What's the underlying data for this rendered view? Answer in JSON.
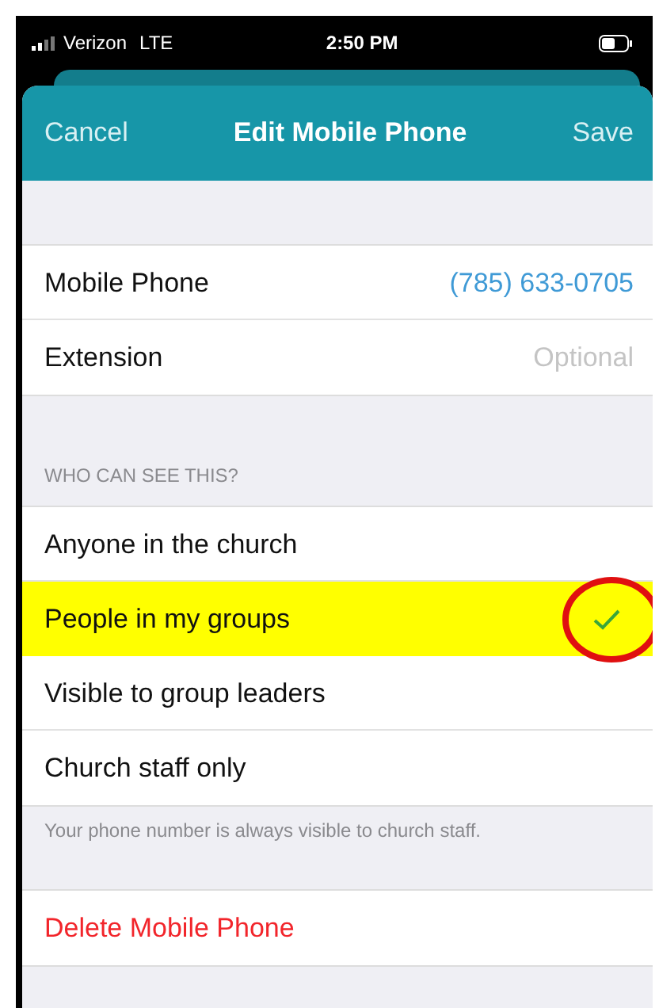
{
  "status_bar": {
    "carrier": "Verizon",
    "network": "LTE",
    "time": "2:50 PM"
  },
  "nav": {
    "cancel": "Cancel",
    "title": "Edit Mobile Phone",
    "save": "Save"
  },
  "fields": [
    {
      "label": "Mobile Phone",
      "value": "(785) 633-0705"
    },
    {
      "label": "Extension",
      "placeholder": "Optional"
    }
  ],
  "visibility": {
    "header": "WHO CAN SEE THIS?",
    "options": [
      {
        "label": "Anyone in the church",
        "selected": false,
        "annotated": false
      },
      {
        "label": "People in my groups",
        "selected": true,
        "annotated": true
      },
      {
        "label": "Visible to group leaders",
        "selected": false,
        "annotated": false
      },
      {
        "label": "Church staff only",
        "selected": false,
        "annotated": false
      }
    ],
    "footer": "Your phone number is always visible to church staff."
  },
  "delete_button": "Delete Mobile Phone"
}
